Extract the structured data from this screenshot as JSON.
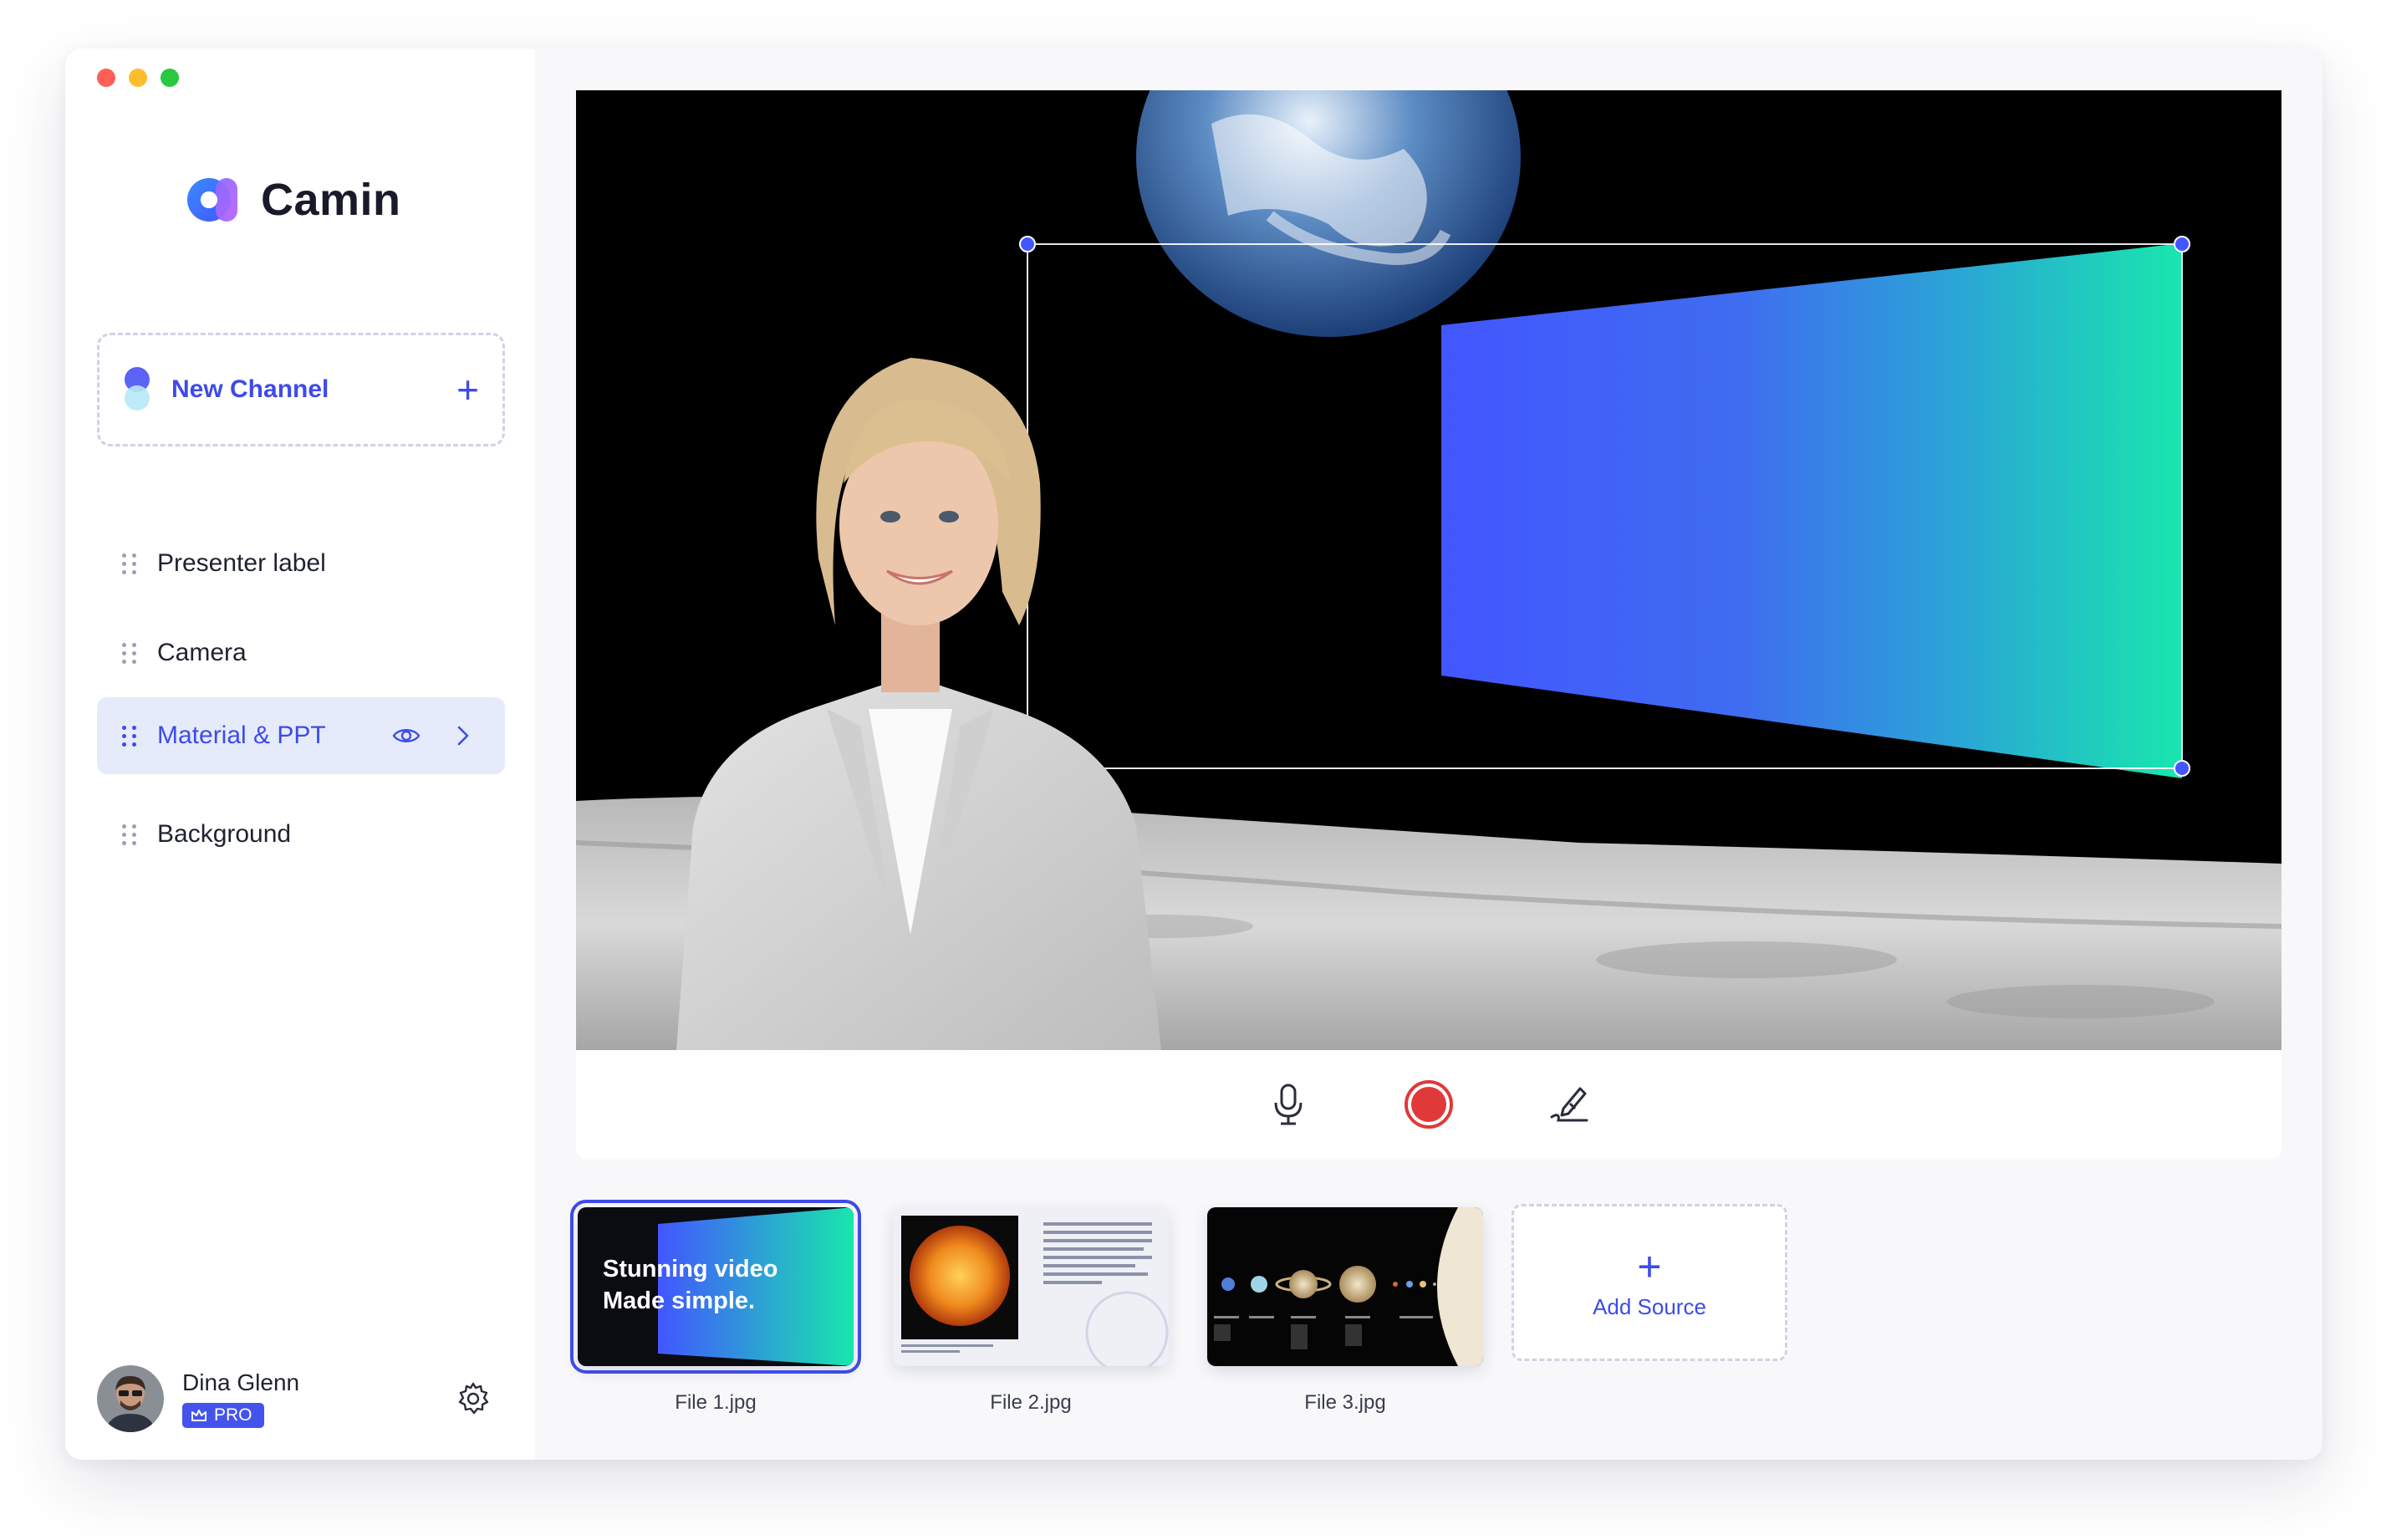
{
  "app": {
    "name": "Camin"
  },
  "sidebar": {
    "new_channel_label": "New Channel",
    "items": [
      {
        "label": "Presenter label",
        "active": false
      },
      {
        "label": "Camera",
        "active": false
      },
      {
        "label": "Material & PPT",
        "active": true
      },
      {
        "label": "Background",
        "active": false
      }
    ]
  },
  "user": {
    "name": "Dina Glenn",
    "badge": "PRO"
  },
  "toolbar": {
    "buttons": [
      "microphone-icon",
      "record-icon",
      "pen-icon"
    ]
  },
  "sources": [
    {
      "caption": "File 1.jpg",
      "title_line1": "Stunning video",
      "title_line2": "Made simple.",
      "selected": true
    },
    {
      "caption": "File 2.jpg",
      "selected": false
    },
    {
      "caption": "File 3.jpg",
      "selected": false
    }
  ],
  "add_source_label": "Add Source",
  "colors": {
    "accent": "#3e4be8",
    "gradient_start": "#4256ff",
    "gradient_end": "#19e6ad",
    "record": "#e0393a"
  }
}
